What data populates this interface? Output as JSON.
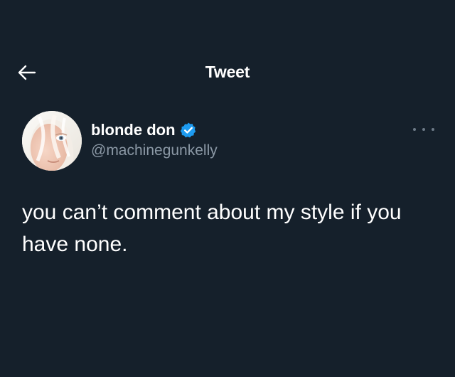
{
  "header": {
    "title": "Tweet",
    "back_icon": "arrow-left-icon"
  },
  "tweet": {
    "author": {
      "display_name": "blonde don",
      "handle": "@machinegunkelly",
      "verified": true,
      "verified_icon": "verified-badge-icon",
      "avatar_icon": "avatar"
    },
    "text": "you can’t comment about my style if you have none.",
    "more_icon": "more-options-icon"
  },
  "colors": {
    "background": "#15202b",
    "text_primary": "#ffffff",
    "text_secondary": "#8b98a5",
    "verified_blue": "#1d9bf0"
  }
}
